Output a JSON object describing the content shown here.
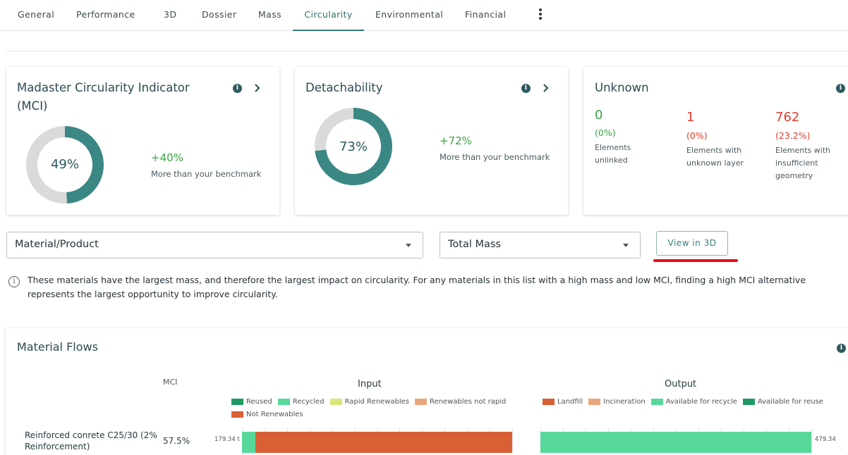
{
  "tabs": [
    {
      "label": "General"
    },
    {
      "label": "Performance"
    },
    {
      "label": "3D"
    },
    {
      "label": "Dossier"
    },
    {
      "label": "Mass"
    },
    {
      "label": "Circularity",
      "active": true
    },
    {
      "label": "Environmental"
    },
    {
      "label": "Financial"
    }
  ],
  "mci_card": {
    "title": "Madaster Circularity Indicator (MCI)",
    "value": 0.49,
    "value_label": "49%",
    "delta": "+40%",
    "delta_sub": "More than your benchmark"
  },
  "detach_card": {
    "title": "Detachability",
    "value": 0.73,
    "value_label": "73%",
    "delta": "+72%",
    "delta_sub": "More than your benchmark"
  },
  "unknown_card": {
    "title": "Unknown",
    "items": [
      {
        "value": "0",
        "pct": "(0%)",
        "label_lines": [
          "Elements",
          "unlinked"
        ],
        "color": "#3aa345"
      },
      {
        "value": "1",
        "pct": "(0%)",
        "label_lines": [
          "Elements with",
          "unknown layer"
        ],
        "color": "#e23b2b"
      },
      {
        "value": "762",
        "pct": "(23.2%)",
        "label_lines": [
          "Elements with",
          "insufficient",
          "geometry"
        ],
        "color": "#e23b2b"
      }
    ]
  },
  "filters": {
    "group_by": "Material/Product",
    "measure": "Total Mass",
    "view_3d": "View in 3D"
  },
  "note": "These materials have the largest mass, and therefore the largest impact on circularity. For any materials in this list with a high mass and low MCI, finding a high MCI alternative represents the largest opportunity to improve circularity.",
  "flows": {
    "title": "Material Flows",
    "mci_header": "MCI",
    "input_header": "Input",
    "output_header": "Output",
    "input_legend": [
      {
        "label": "Reused",
        "color": "#1e9b63"
      },
      {
        "label": "Recycled",
        "color": "#57d89a"
      },
      {
        "label": "Rapid Renewables",
        "color": "#d8e67a"
      },
      {
        "label": "Renewables not rapid",
        "color": "#e8a77a"
      },
      {
        "label": "Not Renewables",
        "color": "#d95f35"
      }
    ],
    "output_legend": [
      {
        "label": "Landfill",
        "color": "#d95f35"
      },
      {
        "label": "Incineration",
        "color": "#e8a77a"
      },
      {
        "label": "Available for recycle",
        "color": "#57d89a"
      },
      {
        "label": "Available for reuse",
        "color": "#1e9b63"
      }
    ],
    "rows": [
      {
        "name": "Reinforced conrete C25/30 (2% Reinforcement)",
        "mci": "57.5%",
        "input_label": "179.34 t",
        "output_label": "479.34",
        "input_fractions": [
          0,
          0.05,
          0,
          0,
          0.95
        ],
        "output_fractions": [
          0,
          0,
          1,
          0
        ]
      }
    ]
  }
}
